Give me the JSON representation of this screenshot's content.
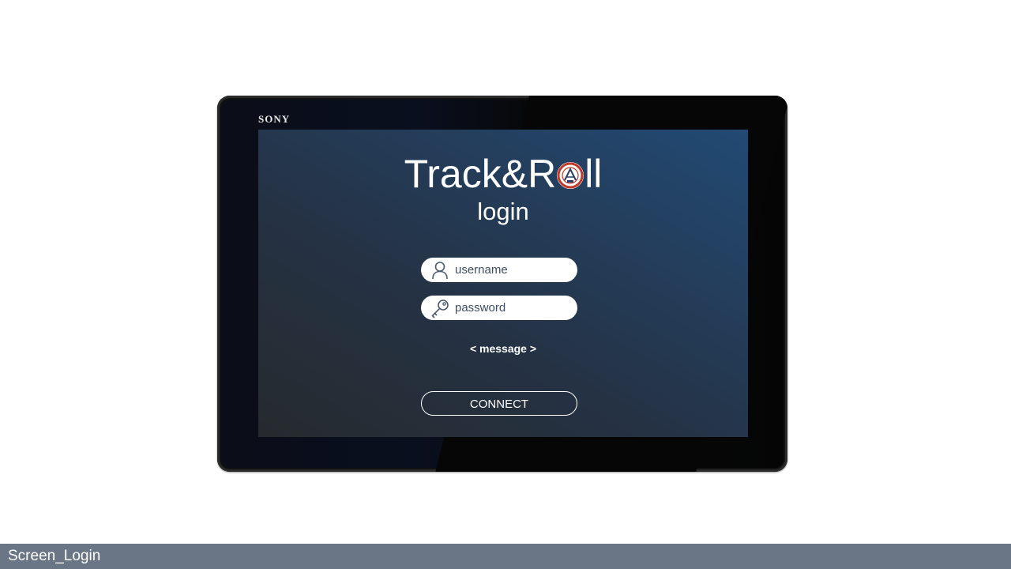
{
  "device": {
    "brand": "SONY"
  },
  "app": {
    "title_before": "Track&R",
    "title_after": "ll",
    "subtitle": "login"
  },
  "form": {
    "username": {
      "value": "",
      "placeholder": "username",
      "icon": "user-icon"
    },
    "password": {
      "value": "",
      "placeholder": "password",
      "icon": "key-icon"
    },
    "message": "< message >",
    "connect_label": "CONNECT"
  },
  "footer": {
    "label": "Screen_Login"
  },
  "colors": {
    "screen_gradient_start": "#262a2e",
    "screen_gradient_end": "#224a74",
    "footer_bar": "#6a7585",
    "logo_accent": "#c0392b"
  }
}
